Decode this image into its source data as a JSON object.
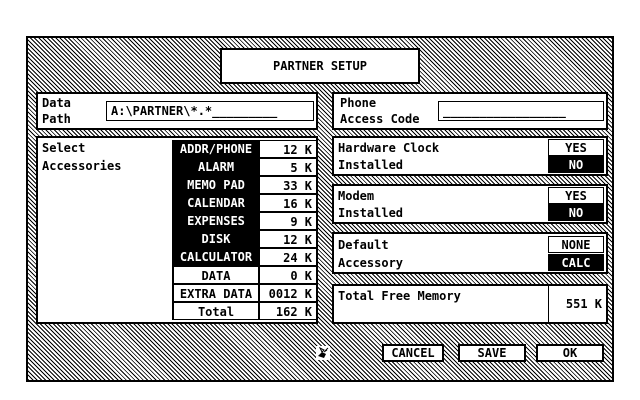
{
  "title": "PARTNER SETUP",
  "data_path": {
    "label_line1": "Data",
    "label_line2": "Path",
    "value": "A:\\PARTNER\\*.*_________"
  },
  "phone": {
    "label_line1": "Phone",
    "label_line2": "Access Code",
    "value": "_________________"
  },
  "accessories": {
    "label_line1": "Select",
    "label_line2": "Accessories",
    "items": [
      {
        "name": "ADDR/PHONE",
        "size": "12 K",
        "selected": true
      },
      {
        "name": "ALARM",
        "size": "5 K",
        "selected": true
      },
      {
        "name": "MEMO PAD",
        "size": "33 K",
        "selected": true
      },
      {
        "name": "CALENDAR",
        "size": "16 K",
        "selected": true
      },
      {
        "name": "EXPENSES",
        "size": "9 K",
        "selected": true
      },
      {
        "name": "DISK",
        "size": "12 K",
        "selected": true
      },
      {
        "name": "CALCULATOR",
        "size": "24 K",
        "selected": true
      },
      {
        "name": "DATA",
        "size": "0 K",
        "selected": false
      },
      {
        "name": "EXTRA DATA",
        "size": "0012 K",
        "selected": false
      }
    ],
    "total_label": "Total",
    "total_value": "162 K"
  },
  "hardware_clock": {
    "label_line1": "Hardware Clock",
    "label_line2": "Installed",
    "opt_yes": "YES",
    "opt_no": "NO",
    "selected": "NO"
  },
  "modem": {
    "label_line1": "Modem",
    "label_line2": "Installed",
    "opt_yes": "YES",
    "opt_no": "NO",
    "selected": "NO"
  },
  "default_accessory": {
    "label_line1": "Default",
    "label_line2": "Accessory",
    "opt_none": "NONE",
    "opt_calc": "CALC",
    "selected": "CALC"
  },
  "free_memory": {
    "label": "Total Free Memory",
    "value": "551 K"
  },
  "buttons": {
    "cancel": "CANCEL",
    "save": "SAVE",
    "ok": "OK"
  }
}
